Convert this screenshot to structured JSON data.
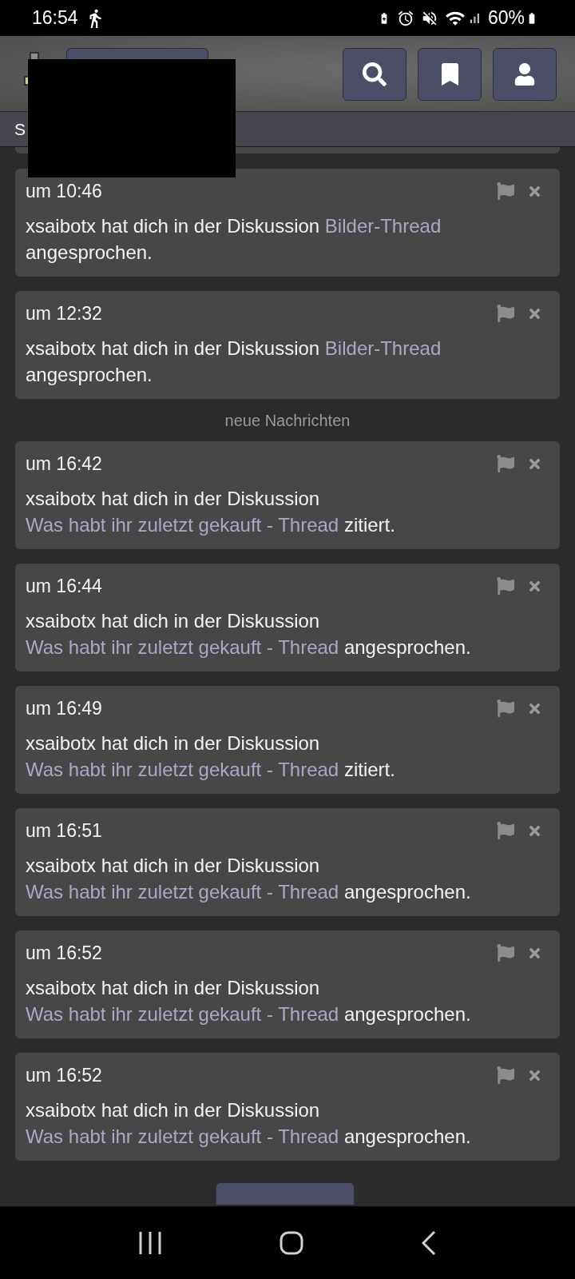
{
  "status_bar": {
    "time": "16:54",
    "battery_text": "60%"
  },
  "subnav": {
    "label": "S"
  },
  "feed": [
    {
      "kind": "notification",
      "time": "um 10:46",
      "text": "xsaibotx hat dich in der Diskussion",
      "link": "Bilder-Thread",
      "suffix": "angesprochen."
    },
    {
      "kind": "notification",
      "time": "um 12:32",
      "text": "xsaibotx hat dich in der Diskussion",
      "link": "Bilder-Thread",
      "suffix": "angesprochen."
    },
    {
      "kind": "divider",
      "label": "neue Nachrichten"
    },
    {
      "kind": "notification",
      "time": "um 16:42",
      "text": "xsaibotx hat dich in der Diskussion",
      "link": "Was habt ihr zuletzt gekauft - Thread",
      "suffix": "zitiert."
    },
    {
      "kind": "notification",
      "time": "um 16:44",
      "text": "xsaibotx hat dich in der Diskussion",
      "link": "Was habt ihr zuletzt gekauft - Thread",
      "suffix": "angesprochen."
    },
    {
      "kind": "notification",
      "time": "um 16:49",
      "text": "xsaibotx hat dich in der Diskussion",
      "link": "Was habt ihr zuletzt gekauft - Thread",
      "suffix": "zitiert."
    },
    {
      "kind": "notification",
      "time": "um 16:51",
      "text": "xsaibotx hat dich in der Diskussion",
      "link": "Was habt ihr zuletzt gekauft - Thread",
      "suffix": "angesprochen."
    },
    {
      "kind": "notification",
      "time": "um 16:52",
      "text": "xsaibotx hat dich in der Diskussion",
      "link": "Was habt ihr zuletzt gekauft - Thread",
      "suffix": "angesprochen."
    },
    {
      "kind": "notification",
      "time": "um 16:52",
      "text": "xsaibotx hat dich in der Diskussion",
      "link": "Was habt ihr zuletzt gekauft - Thread",
      "suffix": "angesprochen."
    }
  ]
}
